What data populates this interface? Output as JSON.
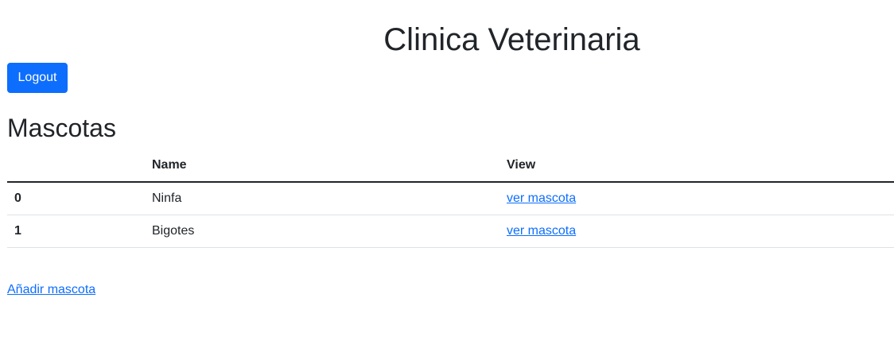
{
  "header": {
    "title": "Clinica Veterinaria",
    "logout_label": "Logout"
  },
  "pets_section": {
    "heading": "Mascotas",
    "columns": [
      "",
      "Name",
      "View"
    ],
    "rows": [
      {
        "id": "0",
        "name": "Ninfa",
        "view_label": "ver mascota"
      },
      {
        "id": "1",
        "name": "Bigotes",
        "view_label": "ver mascota"
      }
    ],
    "add_label": "Añadir mascota"
  },
  "colors": {
    "primary": "#0d6efd",
    "text": "#212529",
    "row_divider": "#dee2e6"
  }
}
